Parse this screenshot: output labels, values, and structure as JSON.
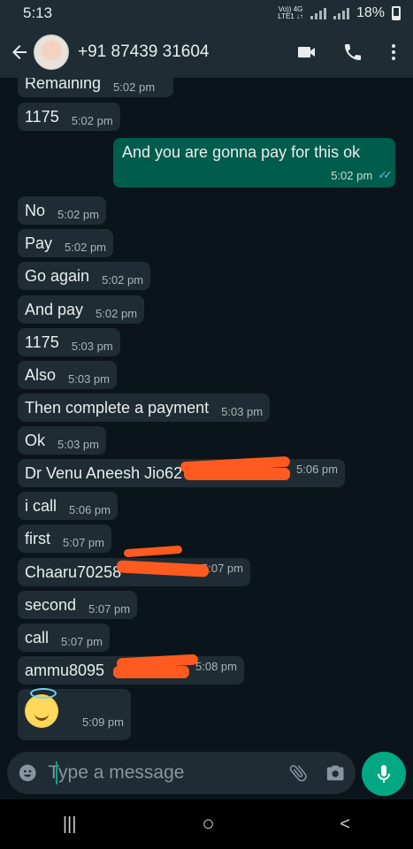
{
  "status": {
    "time": "5:13",
    "net_top": "Vo)) 4G",
    "net_bottom": "LTE1 ↓↑",
    "battery": "18%"
  },
  "header": {
    "contact": "+91 87439 31604",
    "icons": [
      "back-arrow-icon",
      "video-call-icon",
      "phone-icon",
      "more-vert-icon"
    ]
  },
  "messages": [
    {
      "text": "Remaining",
      "time": "5:02 pm",
      "dir": "in"
    },
    {
      "text": "1175",
      "time": "5:02 pm",
      "dir": "in"
    },
    {
      "text": "And you are gonna  pay for this ok",
      "time": "5:02 pm",
      "dir": "out",
      "status": "read"
    },
    {
      "text": "No",
      "time": "5:02 pm",
      "dir": "in"
    },
    {
      "text": "Pay",
      "time": "5:02 pm",
      "dir": "in"
    },
    {
      "text": "Go again",
      "time": "5:02 pm",
      "dir": "in"
    },
    {
      "text": "And pay",
      "time": "5:02 pm",
      "dir": "in"
    },
    {
      "text": "1175",
      "time": "5:03 pm",
      "dir": "in"
    },
    {
      "text": "Also",
      "time": "5:03 pm",
      "dir": "in"
    },
    {
      "text": "Then complete a payment",
      "time": "5:03 pm",
      "dir": "in"
    },
    {
      "text": "Ok",
      "time": "5:03 pm",
      "dir": "in"
    },
    {
      "text": "Dr Venu Aneesh Jio62",
      "time": "5:06 pm",
      "dir": "in",
      "redacted": true
    },
    {
      "text": "i call",
      "time": "5:06 pm",
      "dir": "in"
    },
    {
      "text": "first",
      "time": "5:07 pm",
      "dir": "in"
    },
    {
      "text": "Chaaru70258",
      "time": "5:07 pm",
      "dir": "in",
      "redacted": true
    },
    {
      "text": "second",
      "time": "5:07 pm",
      "dir": "in"
    },
    {
      "text": "call",
      "time": "5:07 pm",
      "dir": "in"
    },
    {
      "text": "ammu8095",
      "time": "5:08 pm",
      "dir": "in",
      "redacted": true
    },
    {
      "text": "",
      "time": "5:09 pm",
      "dir": "in",
      "emoji": "smiling-face-with-halo"
    }
  ],
  "composer": {
    "placeholder": "Type a message",
    "icons": [
      "emoji-icon",
      "attach-icon",
      "camera-icon",
      "mic-icon"
    ]
  },
  "navbar": {
    "recent": "|||",
    "home": "○",
    "back": "<"
  },
  "colors": {
    "incoming_bubble": "#202c33",
    "outgoing_bubble": "#005c4b",
    "accent": "#00a884",
    "read_ticks": "#53bdeb",
    "redaction": "#ff5a1f"
  }
}
